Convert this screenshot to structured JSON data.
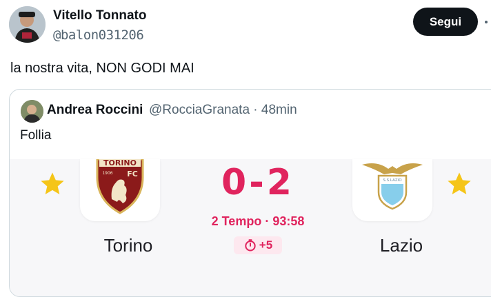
{
  "post": {
    "author_name": "Vitello Tonnato",
    "author_handle": "@balon031206",
    "follow_label": "Segui",
    "text": "la nostra vita, NON GODI MAI"
  },
  "quote": {
    "author_name": "Andrea Roccini",
    "meta": "@RocciaGranata · 48min",
    "text": "Follia",
    "match": {
      "home_team": "Torino",
      "away_team": "Lazio",
      "home_crest_text": "TORINO",
      "home_crest_badge": "FC",
      "home_crest_year": "1906",
      "away_crest_text": "S.S.LAZIO",
      "score": "0-2",
      "status": "2 Tempo · 93:58",
      "added_time": "+5"
    }
  },
  "colors": {
    "accent": "#e0245e",
    "star": "#f5c518",
    "torino": "#8b1a1a",
    "lazio": "#87ceeb"
  }
}
